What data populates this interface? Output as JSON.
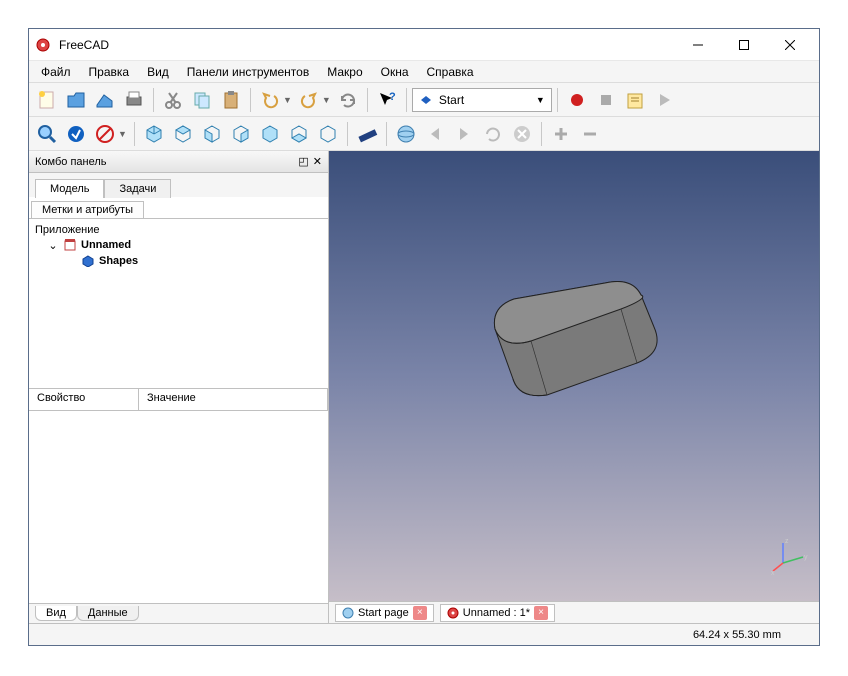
{
  "app": {
    "title": "FreeCAD"
  },
  "menu": [
    "Файл",
    "Правка",
    "Вид",
    "Панели инструментов",
    "Макро",
    "Окна",
    "Справка"
  ],
  "workbench": {
    "selected": "Start"
  },
  "combo": {
    "title": "Комбо панель",
    "tabs": {
      "model": "Модель",
      "tasks": "Задачи"
    },
    "subtab": "Метки и атрибуты",
    "tree": {
      "app": "Приложение",
      "doc": "Unnamed",
      "shape": "Shapes"
    },
    "prop_headers": {
      "name": "Свойство",
      "value": "Значение"
    },
    "bottom_tabs": {
      "view": "Вид",
      "data": "Данные"
    }
  },
  "doc_tabs": {
    "start": "Start page",
    "unnamed": "Unnamed : 1*"
  },
  "status": {
    "dims": "64.24 x 55.30  mm"
  }
}
